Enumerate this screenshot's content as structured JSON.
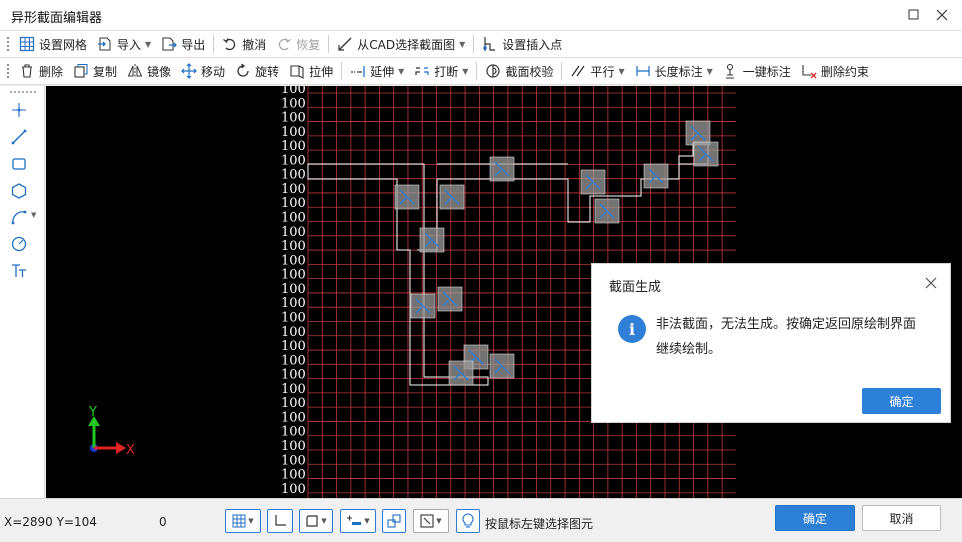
{
  "window": {
    "title": "异形截面编辑器"
  },
  "toolbar1": [
    {
      "label": "设置网格",
      "icon": "grid-icon"
    },
    {
      "label": "导入",
      "icon": "import-icon",
      "dropdown": true
    },
    {
      "label": "导出",
      "icon": "export-icon"
    },
    {
      "label": "撤消",
      "icon": "undo-icon"
    },
    {
      "label": "恢复",
      "icon": "redo-icon",
      "disabled": true,
      "dropdown": true
    },
    {
      "label": "从CAD选择截面图",
      "icon": "cad-select-icon",
      "dropdown": true
    },
    {
      "label": "设置插入点",
      "icon": "insert-point-icon"
    }
  ],
  "toolbar2": [
    {
      "label": "删除",
      "icon": "trash-icon"
    },
    {
      "label": "复制",
      "icon": "copy-icon"
    },
    {
      "label": "镜像",
      "icon": "mirror-icon"
    },
    {
      "label": "移动",
      "icon": "move-icon"
    },
    {
      "label": "旋转",
      "icon": "rotate-icon"
    },
    {
      "label": "拉伸",
      "icon": "stretch-icon"
    },
    {
      "label": "延伸",
      "icon": "extend-icon",
      "dropdown": true
    },
    {
      "label": "打断",
      "icon": "break-icon",
      "dropdown": true
    },
    {
      "label": "截面校验",
      "icon": "section-check-icon"
    },
    {
      "label": "平行",
      "icon": "parallel-icon",
      "dropdown": true
    },
    {
      "label": "长度标注",
      "icon": "dimension-icon",
      "dropdown": true
    },
    {
      "label": "一键标注",
      "icon": "auto-dimension-icon"
    },
    {
      "label": "删除约束",
      "icon": "delete-constraint-icon"
    }
  ],
  "left_tools": [
    "point-icon",
    "line-icon",
    "rectangle-icon",
    "polygon-icon",
    "arc-icon",
    "circle-icon",
    "text-icon"
  ],
  "canvas": {
    "ruler_label": "100",
    "axis_x": "X",
    "axis_y": "Y",
    "grid_color": "#c0393b",
    "outline_color": "#ffffff"
  },
  "status": {
    "coords": "X=2890 Y=104",
    "value": "0",
    "hint": "按鼠标左键选择图元",
    "ok": "确定",
    "cancel": "取消"
  },
  "dialog": {
    "title": "截面生成",
    "message": "非法截面，无法生成。按确定返回原绘制界面继续绘制。",
    "ok": "确定"
  },
  "colors": {
    "accent": "#2d80d8"
  }
}
